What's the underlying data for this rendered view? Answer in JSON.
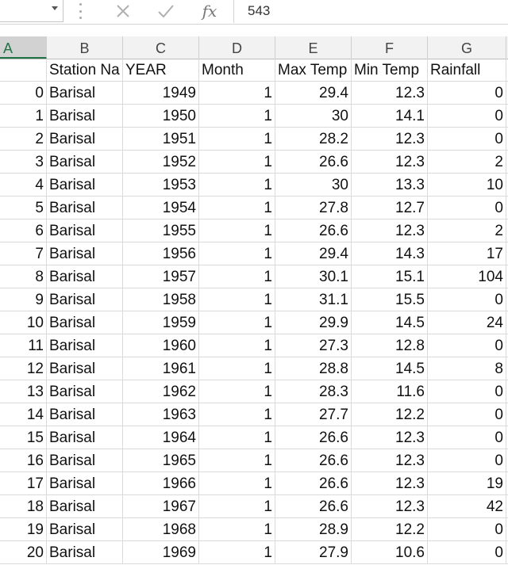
{
  "formula_bar": {
    "name_box_value": "",
    "cancel_icon": "close-icon",
    "enter_icon": "check-icon",
    "fx_label": "fx",
    "formula_value": "543"
  },
  "columns": [
    "A",
    "B",
    "C",
    "D",
    "E",
    "F",
    "G"
  ],
  "selected_column": "A",
  "header_row": [
    "",
    "Station Na",
    "YEAR",
    "Month",
    "Max Temp",
    "Min Temp",
    "Rainfall"
  ],
  "rows": [
    [
      "0",
      "Barisal",
      "1949",
      "1",
      "29.4",
      "12.3",
      "0"
    ],
    [
      "1",
      "Barisal",
      "1950",
      "1",
      "30",
      "14.1",
      "0"
    ],
    [
      "2",
      "Barisal",
      "1951",
      "1",
      "28.2",
      "12.3",
      "0"
    ],
    [
      "3",
      "Barisal",
      "1952",
      "1",
      "26.6",
      "12.3",
      "2"
    ],
    [
      "4",
      "Barisal",
      "1953",
      "1",
      "30",
      "13.3",
      "10"
    ],
    [
      "5",
      "Barisal",
      "1954",
      "1",
      "27.8",
      "12.7",
      "0"
    ],
    [
      "6",
      "Barisal",
      "1955",
      "1",
      "26.6",
      "12.3",
      "2"
    ],
    [
      "7",
      "Barisal",
      "1956",
      "1",
      "29.4",
      "14.3",
      "17"
    ],
    [
      "8",
      "Barisal",
      "1957",
      "1",
      "30.1",
      "15.1",
      "104"
    ],
    [
      "9",
      "Barisal",
      "1958",
      "1",
      "31.1",
      "15.5",
      "0"
    ],
    [
      "10",
      "Barisal",
      "1959",
      "1",
      "29.9",
      "14.5",
      "24"
    ],
    [
      "11",
      "Barisal",
      "1960",
      "1",
      "27.3",
      "12.8",
      "0"
    ],
    [
      "12",
      "Barisal",
      "1961",
      "1",
      "28.8",
      "14.5",
      "8"
    ],
    [
      "13",
      "Barisal",
      "1962",
      "1",
      "28.3",
      "11.6",
      "0"
    ],
    [
      "14",
      "Barisal",
      "1963",
      "1",
      "27.7",
      "12.2",
      "0"
    ],
    [
      "15",
      "Barisal",
      "1964",
      "1",
      "26.6",
      "12.3",
      "0"
    ],
    [
      "16",
      "Barisal",
      "1965",
      "1",
      "26.6",
      "12.3",
      "0"
    ],
    [
      "17",
      "Barisal",
      "1966",
      "1",
      "26.6",
      "12.3",
      "19"
    ],
    [
      "18",
      "Barisal",
      "1967",
      "1",
      "26.6",
      "12.3",
      "42"
    ],
    [
      "19",
      "Barisal",
      "1968",
      "1",
      "28.9",
      "12.2",
      "0"
    ],
    [
      "20",
      "Barisal",
      "1969",
      "1",
      "27.9",
      "10.6",
      "0"
    ]
  ],
  "colors": {
    "selected_header": "#217346",
    "header_bg": "#f2f2f2",
    "gridline": "#dadada"
  }
}
